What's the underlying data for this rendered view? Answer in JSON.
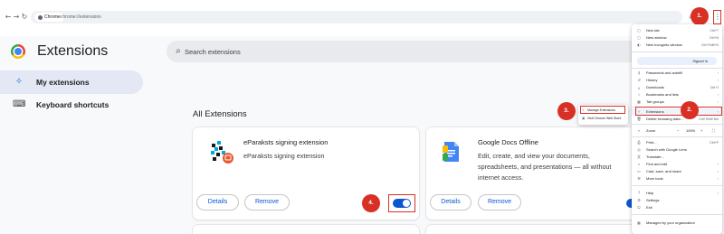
{
  "browser": {
    "site_chip": "Chrome",
    "url": "chrome://extensions"
  },
  "page": {
    "title": "Extensions",
    "search_placeholder": "Search extensions"
  },
  "sidebar": {
    "items": [
      {
        "label": "My extensions",
        "icon": "extensions-puzzle-icon",
        "active": true
      },
      {
        "label": "Keyboard shortcuts",
        "icon": "keyboard-icon",
        "active": false
      }
    ]
  },
  "main": {
    "section_title": "All Extensions",
    "cards": [
      {
        "name": "eParaksts signing extension",
        "description": "eParaksts signing extension",
        "details_label": "Details",
        "remove_label": "Remove",
        "enabled": true
      },
      {
        "name": "Google Docs Offline",
        "description_lines": [
          "Edit, create, and view your documents,",
          "spreadsheets, and presentations — all without",
          "internet access."
        ],
        "details_label": "Details",
        "remove_label": "Remove",
        "enabled": true
      }
    ]
  },
  "annotations": {
    "step1": "1.",
    "step2": "2.",
    "step3": "3.",
    "step4": "4.",
    "color": "#d93025"
  },
  "chrome_menu": {
    "items": [
      {
        "label": "New tab",
        "shortcut": "Ctrl+T",
        "icon": "new-tab-icon"
      },
      {
        "label": "New window",
        "shortcut": "Ctrl+N",
        "icon": "new-window-icon"
      },
      {
        "label": "New Incognito window",
        "shortcut": "Ctrl+Shift+N",
        "icon": "incognito-icon"
      },
      {
        "label": "Signed in",
        "icon": "profile-icon"
      },
      {
        "label": "Passwords and autofill",
        "shortcut": "",
        "icon": "key-icon"
      },
      {
        "label": "History",
        "shortcut": "",
        "icon": "history-icon"
      },
      {
        "label": "Downloads",
        "shortcut": "Ctrl+J",
        "icon": "download-icon"
      },
      {
        "label": "Bookmarks and lists",
        "shortcut": "",
        "icon": "star-icon"
      },
      {
        "label": "Tab groups",
        "shortcut": "",
        "icon": "tab-groups-icon"
      },
      {
        "label": "Extensions",
        "shortcut": "",
        "icon": "extensions-icon"
      },
      {
        "label": "Delete browsing data...",
        "shortcut": "Ctrl+Shift+Del",
        "icon": "trash-icon"
      },
      {
        "label": "Zoom",
        "value": "100%",
        "icon": "zoom-icon"
      },
      {
        "label": "Print...",
        "shortcut": "Ctrl+P",
        "icon": "print-icon"
      },
      {
        "label": "Search with Google Lens",
        "shortcut": "",
        "icon": "lens-icon"
      },
      {
        "label": "Translate...",
        "shortcut": "",
        "icon": "translate-icon"
      },
      {
        "label": "Find and edit",
        "shortcut": "",
        "icon": "find-icon"
      },
      {
        "label": "Cast, save, and share",
        "shortcut": "",
        "icon": "cast-icon"
      },
      {
        "label": "More tools",
        "shortcut": "",
        "icon": "tools-icon"
      },
      {
        "label": "Help",
        "shortcut": "",
        "icon": "help-icon"
      },
      {
        "label": "Settings",
        "shortcut": "",
        "icon": "settings-icon"
      },
      {
        "label": "Exit",
        "shortcut": "",
        "icon": "exit-icon"
      },
      {
        "label": "Managed by your organization",
        "shortcut": "",
        "icon": "managed-icon"
      }
    ],
    "submenu": [
      {
        "label": "Manage Extensions",
        "icon": "puzzle-icon"
      },
      {
        "label": "Visit Chrome Web Store",
        "icon": "web-store-icon"
      }
    ]
  }
}
